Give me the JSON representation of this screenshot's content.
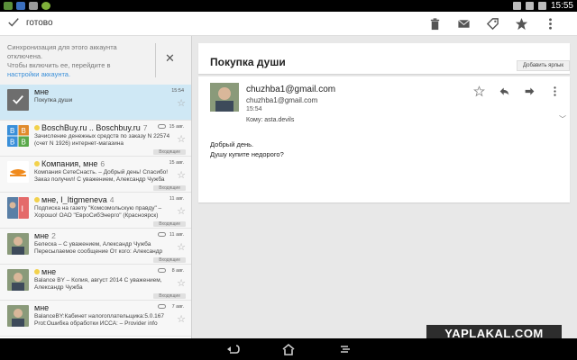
{
  "statusbar": {
    "time": "15:55"
  },
  "actionbar": {
    "done_label": "готово"
  },
  "sync_notice": {
    "line1": "Синхронизация для этого аккаунта",
    "line2": "отключена.",
    "line3": "Чтобы включить ее, перейдите в",
    "link": "настройки аккаунта."
  },
  "list": [
    {
      "sender": "мне",
      "count": "",
      "date": "15:54",
      "snippet": "Покупка души",
      "label": "",
      "attachment": false,
      "selected": true
    },
    {
      "sender": "BoschBuy.ru .. Boschbuy.ru",
      "count": "7",
      "date": "15 авг.",
      "snippet": "Зачисление денежных средств по заказу N 22574 (счет N 1926) интернет-магазина",
      "label": "Входящие",
      "attachment": true,
      "selected": false
    },
    {
      "sender": "Компания, мне",
      "count": "6",
      "date": "15 авг.",
      "snippet": "Компания СетеСнасть. – Добрый день! Спасибо! Заказ получил! С уважением, Александр Чужба",
      "label": "Входящие",
      "attachment": false,
      "selected": false
    },
    {
      "sender": "мне, I_Itigmeneva",
      "count": "4",
      "date": "11 авг.",
      "snippet": "Подписка на газету \"Комсомольскую правду\" – Хорошо! ОАО \"ЕвроСибЭнерго\" (Красноярск) ОАО",
      "label": "Входящие",
      "attachment": false,
      "selected": false
    },
    {
      "sender": "мне",
      "count": "2",
      "date": "11 авг.",
      "snippet": "Белеска – С уважением, Александр Чужба Пересылаемое сообщение  От кого: Александр",
      "label": "Входящие",
      "attachment": true,
      "selected": false
    },
    {
      "sender": "мне",
      "count": "",
      "date": "8 авг.",
      "snippet": "Balance BY – Копия, август 2014 С уважением, Александр Чужба",
      "label": "Входящие",
      "attachment": true,
      "selected": false
    },
    {
      "sender": "мне",
      "count": "",
      "date": "7 авг.",
      "snippet": "BalanceBY:Кабинет налогоплательщика:5.0.167 Prot:Ошибка обработки ИССА: – Provider info",
      "label": "",
      "attachment": true,
      "selected": false
    }
  ],
  "message": {
    "subject": "Покупка души",
    "add_label": "Добавить ярлык",
    "from_name": "chuzhba1@gmail.com",
    "from_email": "chuzhba1@gmail.com",
    "time": "15:54",
    "to": "Кому: asta.devils",
    "body_line1": "Добрый день.",
    "body_line2": "Душу купите недорого?"
  },
  "watermark": "YAPLAKAL.COM",
  "colors": {
    "selected_row": "#cfe8f5",
    "link": "#3a8fd9",
    "important_marker": "#f2d14b"
  }
}
